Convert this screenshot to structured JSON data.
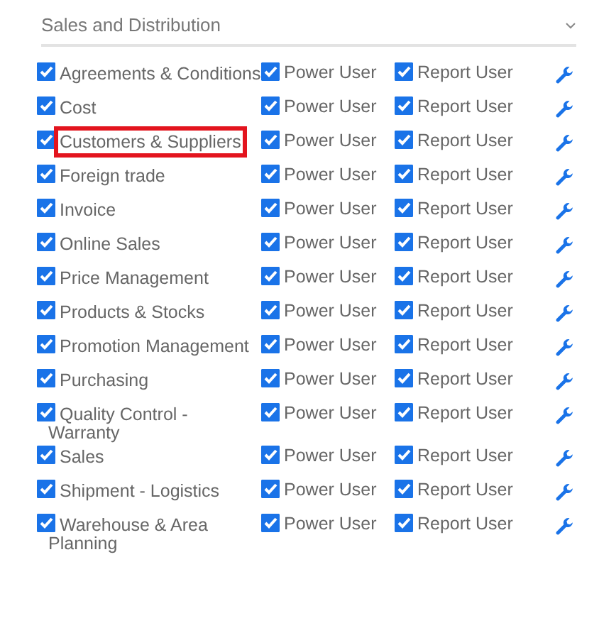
{
  "section": {
    "title": "Sales and Distribution",
    "expanded": true
  },
  "modules": [
    {
      "name": "Agreements & Conditions",
      "checked": true,
      "highlighted": false,
      "power_user": {
        "label": "Power User",
        "checked": true
      },
      "report_user": {
        "label": "Report User",
        "checked": true
      }
    },
    {
      "name": "Cost",
      "checked": true,
      "highlighted": false,
      "power_user": {
        "label": "Power User",
        "checked": true
      },
      "report_user": {
        "label": "Report User",
        "checked": true
      }
    },
    {
      "name": "Customers & Suppliers",
      "checked": true,
      "highlighted": true,
      "power_user": {
        "label": "Power User",
        "checked": true
      },
      "report_user": {
        "label": "Report User",
        "checked": true
      }
    },
    {
      "name": "Foreign trade",
      "checked": true,
      "highlighted": false,
      "power_user": {
        "label": "Power User",
        "checked": true
      },
      "report_user": {
        "label": "Report User",
        "checked": true
      }
    },
    {
      "name": "Invoice",
      "checked": true,
      "highlighted": false,
      "power_user": {
        "label": "Power User",
        "checked": true
      },
      "report_user": {
        "label": "Report User",
        "checked": true
      }
    },
    {
      "name": "Online Sales",
      "checked": true,
      "highlighted": false,
      "power_user": {
        "label": "Power User",
        "checked": true
      },
      "report_user": {
        "label": "Report User",
        "checked": true
      }
    },
    {
      "name": "Price Management",
      "checked": true,
      "highlighted": false,
      "power_user": {
        "label": "Power User",
        "checked": true
      },
      "report_user": {
        "label": "Report User",
        "checked": true
      }
    },
    {
      "name": "Products & Stocks",
      "checked": true,
      "highlighted": false,
      "power_user": {
        "label": "Power User",
        "checked": true
      },
      "report_user": {
        "label": "Report User",
        "checked": true
      }
    },
    {
      "name": "Promotion Management",
      "checked": true,
      "highlighted": false,
      "power_user": {
        "label": "Power User",
        "checked": true
      },
      "report_user": {
        "label": "Report User",
        "checked": true
      }
    },
    {
      "name": "Purchasing",
      "checked": true,
      "highlighted": false,
      "power_user": {
        "label": "Power User",
        "checked": true
      },
      "report_user": {
        "label": "Report User",
        "checked": true
      }
    },
    {
      "name": "Quality Control - Warranty",
      "checked": true,
      "highlighted": false,
      "power_user": {
        "label": "Power User",
        "checked": true
      },
      "report_user": {
        "label": "Report User",
        "checked": true
      }
    },
    {
      "name": "Sales",
      "checked": true,
      "highlighted": false,
      "power_user": {
        "label": "Power User",
        "checked": true
      },
      "report_user": {
        "label": "Report User",
        "checked": true
      }
    },
    {
      "name": "Shipment - Logistics",
      "checked": true,
      "highlighted": false,
      "power_user": {
        "label": "Power User",
        "checked": true
      },
      "report_user": {
        "label": "Report User",
        "checked": true
      }
    },
    {
      "name": "Warehouse & Area Planning",
      "checked": true,
      "highlighted": false,
      "power_user": {
        "label": "Power User",
        "checked": true
      },
      "report_user": {
        "label": "Report User",
        "checked": true
      }
    }
  ]
}
